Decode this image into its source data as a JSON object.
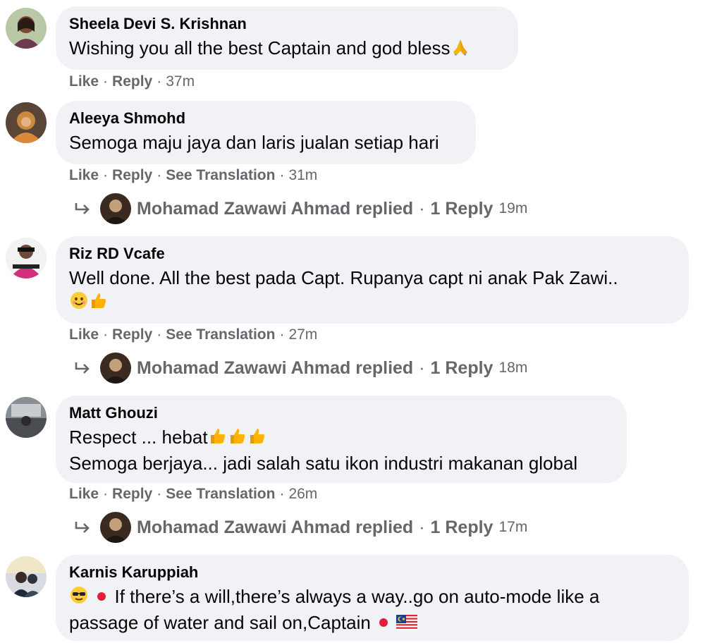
{
  "comments": [
    {
      "name": "Sheela Devi S. Krishnan",
      "text": "Wishing you all the best Captain and god bless",
      "actions": {
        "like": "Like",
        "reply": "Reply",
        "time": "37m"
      }
    },
    {
      "name": "Aleeya Shmohd",
      "text": "Semoga maju jaya dan laris jualan setiap hari",
      "actions": {
        "like": "Like",
        "reply": "Reply",
        "translation": "See Translation",
        "time": "31m"
      },
      "replies": {
        "author": "Mohamad Zawawi Ahmad replied",
        "count": "1 Reply",
        "time": "19m"
      }
    },
    {
      "name": "Riz RD Vcafe",
      "text": "Well done. All the best pada Capt. Rupanya capt ni anak Pak Zawi..",
      "actions": {
        "like": "Like",
        "reply": "Reply",
        "translation": "See Translation",
        "time": "27m"
      },
      "replies": {
        "author": "Mohamad Zawawi Ahmad replied",
        "count": "1 Reply",
        "time": "18m"
      }
    },
    {
      "name": "Matt Ghouzi",
      "text_line1": "Respect ... hebat",
      "text_line2": "Semoga berjaya... jadi salah satu ikon industri makanan global",
      "actions": {
        "like": "Like",
        "reply": "Reply",
        "translation": "See Translation",
        "time": "26m"
      },
      "replies": {
        "author": "Mohamad Zawawi Ahmad replied",
        "count": "1 Reply",
        "time": "17m"
      }
    },
    {
      "name": "Karnis Karuppiah",
      "text_line1": "If there’s a will,there’s always a way..go on auto-mode like a",
      "text_line2": "passage of water and sail on,Captain"
    }
  ],
  "separator": "·",
  "icons": [
    "folded-hands-emoji",
    "smiling-face-emoji",
    "thumbs-up-emoji",
    "sunglasses-emoji",
    "japan-flag-emoji",
    "malaysia-flag-emoji",
    "reply-arrow-icon"
  ],
  "colors": {
    "bubble": "#f0f2f5",
    "meta": "#65676b",
    "text": "#050505"
  }
}
